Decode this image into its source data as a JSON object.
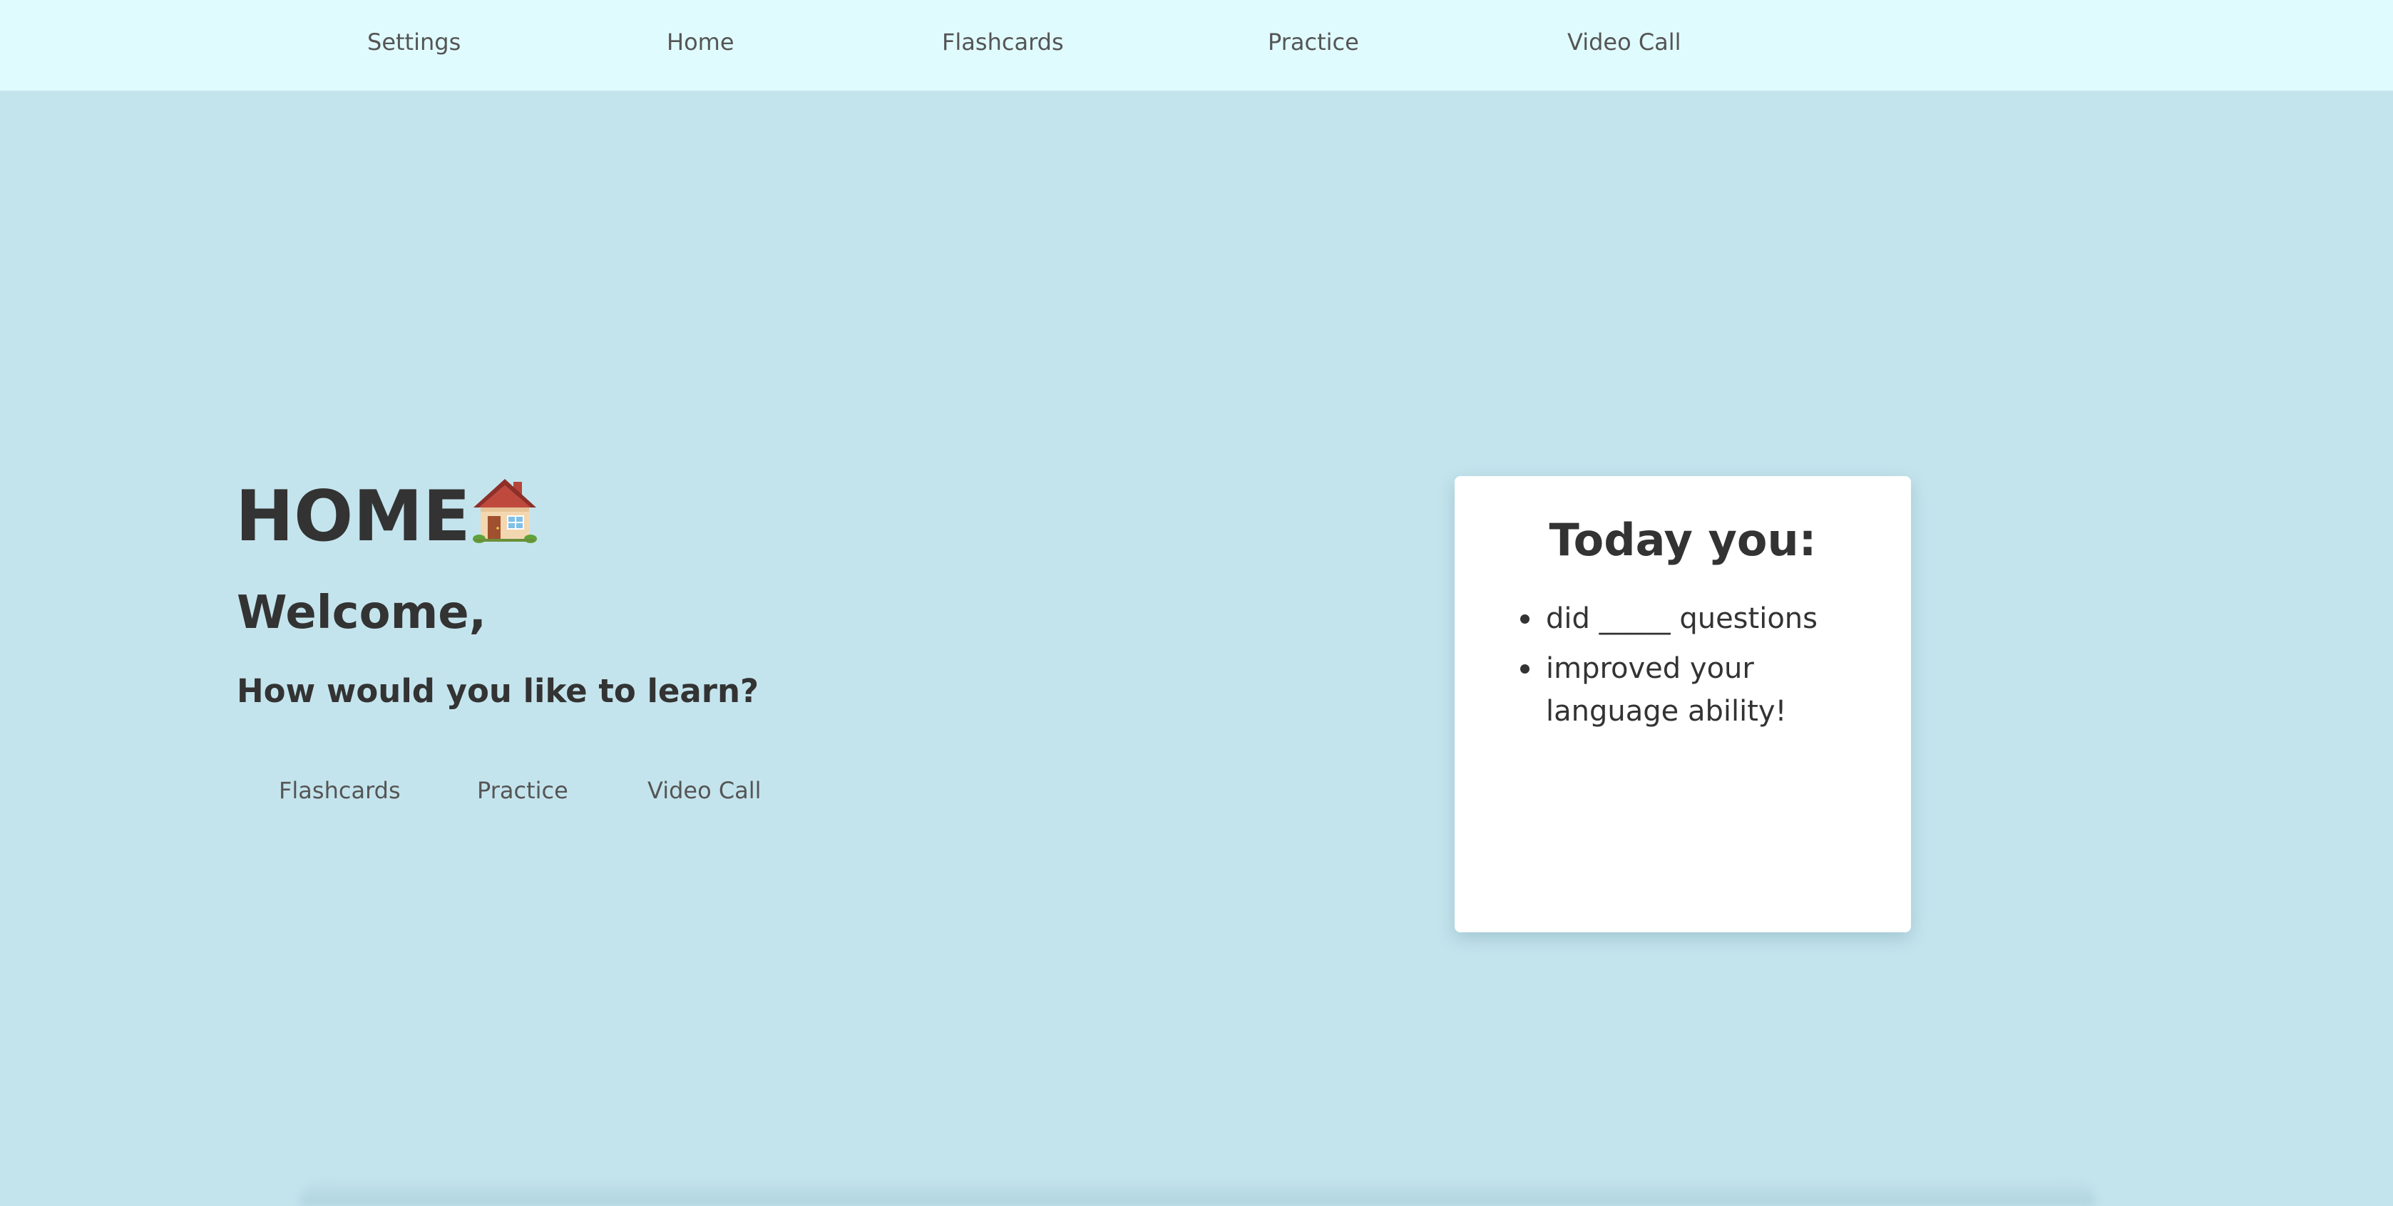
{
  "nav": {
    "items": [
      {
        "label": "Settings"
      },
      {
        "label": "Home"
      },
      {
        "label": "Flashcards"
      },
      {
        "label": "Practice"
      },
      {
        "label": "Video Call"
      }
    ]
  },
  "main": {
    "title": "HOME",
    "title_icon": "house-icon",
    "welcome": "Welcome,",
    "question": "How would you like to learn?",
    "options": [
      {
        "label": "Flashcards"
      },
      {
        "label": "Practice"
      },
      {
        "label": "Video Call"
      }
    ]
  },
  "today_card": {
    "title": "Today you:",
    "items": [
      "did _____ questions",
      "improved your language ability!"
    ]
  },
  "colors": {
    "nav_background": "#e0fbfd",
    "page_background": "#c4e4ed",
    "card_background": "#ffffff",
    "text": "#333333",
    "link_text": "#555555"
  }
}
